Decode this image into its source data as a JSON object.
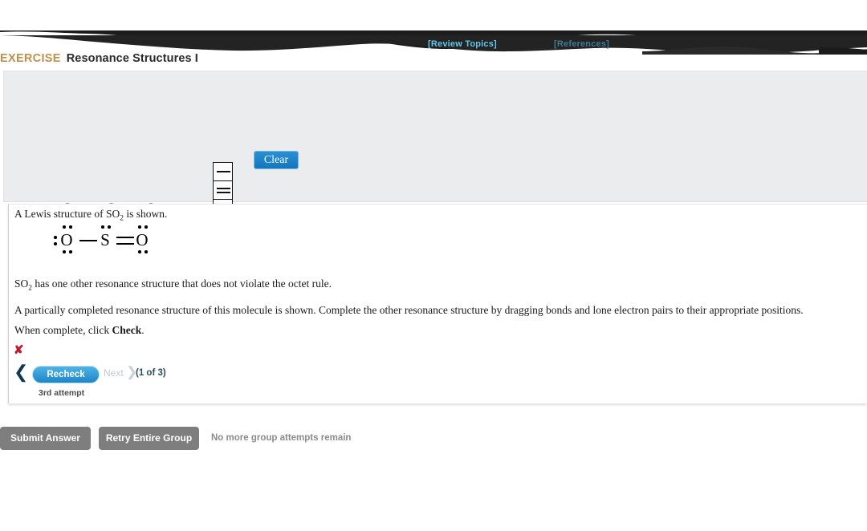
{
  "topbar": {
    "review_topics": "[Review Topics]",
    "references": "[References]"
  },
  "exercise": {
    "label": "EXERCISE",
    "title": "Resonance Structures I"
  },
  "canvas": {
    "clear_label": "Clear",
    "atoms": [
      {
        "symbol": "O",
        "name": "oxygen-left"
      },
      {
        "symbol": "S",
        "name": "sulfur-center"
      },
      {
        "symbol": "O",
        "name": "oxygen-right"
      }
    ],
    "tools": [
      {
        "name": "single-bond-tool",
        "bonds": 1
      },
      {
        "name": "double-bond-tool",
        "bonds": 2
      },
      {
        "name": "triple-bond-tool",
        "bonds": 3
      },
      {
        "name": "lone-pair-tool",
        "bonds": 0
      }
    ]
  },
  "question": {
    "line1_prefix": "A Lewis structure of SO",
    "line1_sub": "2",
    "line1_suffix": " is shown.",
    "line2_prefix": "SO",
    "line2_sub": "2",
    "line2_suffix": " has one other resonance structure that does not violate the octet rule.",
    "line3": "A partically completed resonance structure of this molecule is shown. Complete the other resonance structure by dragging bonds and lone electron pairs to their appropriate positions.",
    "line4_prefix": "When complete, click ",
    "line4_bold": "Check",
    "line4_suffix": "."
  },
  "lewis_structure": {
    "left_atom": "O",
    "center_atom": "S",
    "right_atom": "O",
    "left_bond": "single",
    "right_bond": "double"
  },
  "feedback": {
    "mark": "✘",
    "prev_chevron": "❮",
    "recheck_label": "Recheck",
    "next_label": "Next",
    "next_chevron": "❯",
    "progress": "(1 of 3)",
    "attempt": "3rd attempt"
  },
  "actions": {
    "submit_label": "Submit Answer",
    "retry_label": "Retry Entire Group",
    "no_attempts": "No more group attempts remain"
  },
  "colors": {
    "exercise_label": "#c2904b",
    "primary_blue": "#1c86c8",
    "error_red": "#c0182d",
    "gray_button": "#7e7e7e",
    "link_blue": "#63c6e8"
  }
}
